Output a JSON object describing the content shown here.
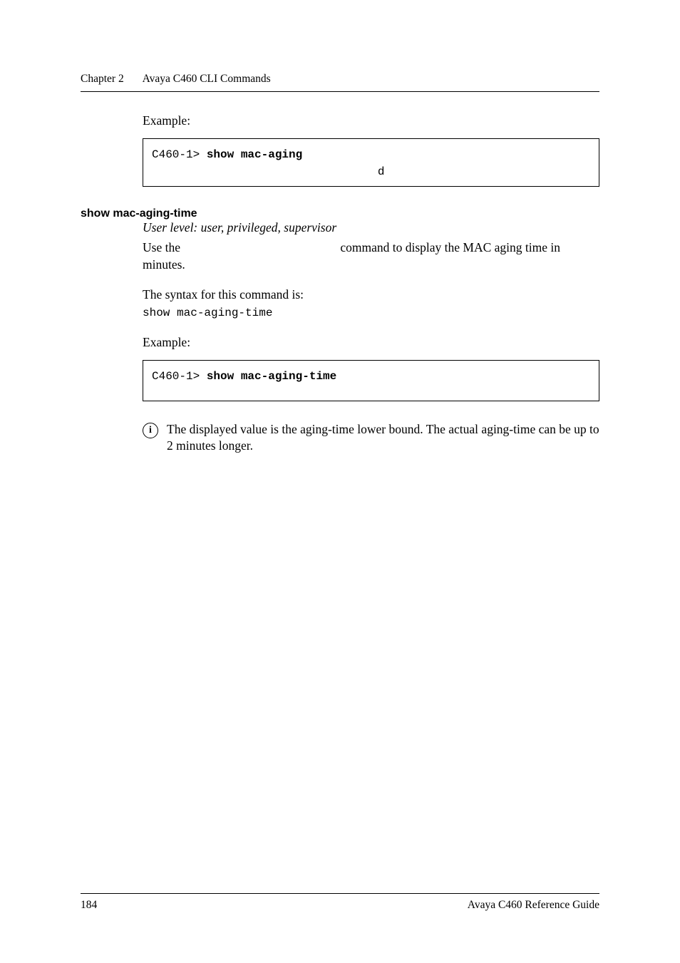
{
  "header": {
    "chapter_label": "Chapter 2",
    "chapter_title": "Avaya C460 CLI Commands"
  },
  "block1": {
    "example_label": "Example:",
    "code_prompt": "C460-1> ",
    "code_cmd": "show mac-aging",
    "code_line2": "                                 d"
  },
  "section": {
    "heading": "show mac-aging-time",
    "user_level": "User level: user, privileged, supervisor",
    "use_pre": "Use the ",
    "use_cmd": "",
    "use_post": "command to display the MAC aging time in minutes.",
    "syntax_label": "The syntax for this command is:",
    "syntax_code": "show mac-aging-time",
    "example_label": "Example:",
    "box_prompt": "C460-1> ",
    "box_cmd": "show mac-aging-time",
    "note_icon": "i",
    "note_text": "The displayed value is the aging-time lower bound. The actual aging-time can be up to 2 minutes longer."
  },
  "footer": {
    "page_number": "184",
    "doc_title": "Avaya C460 Reference Guide"
  }
}
